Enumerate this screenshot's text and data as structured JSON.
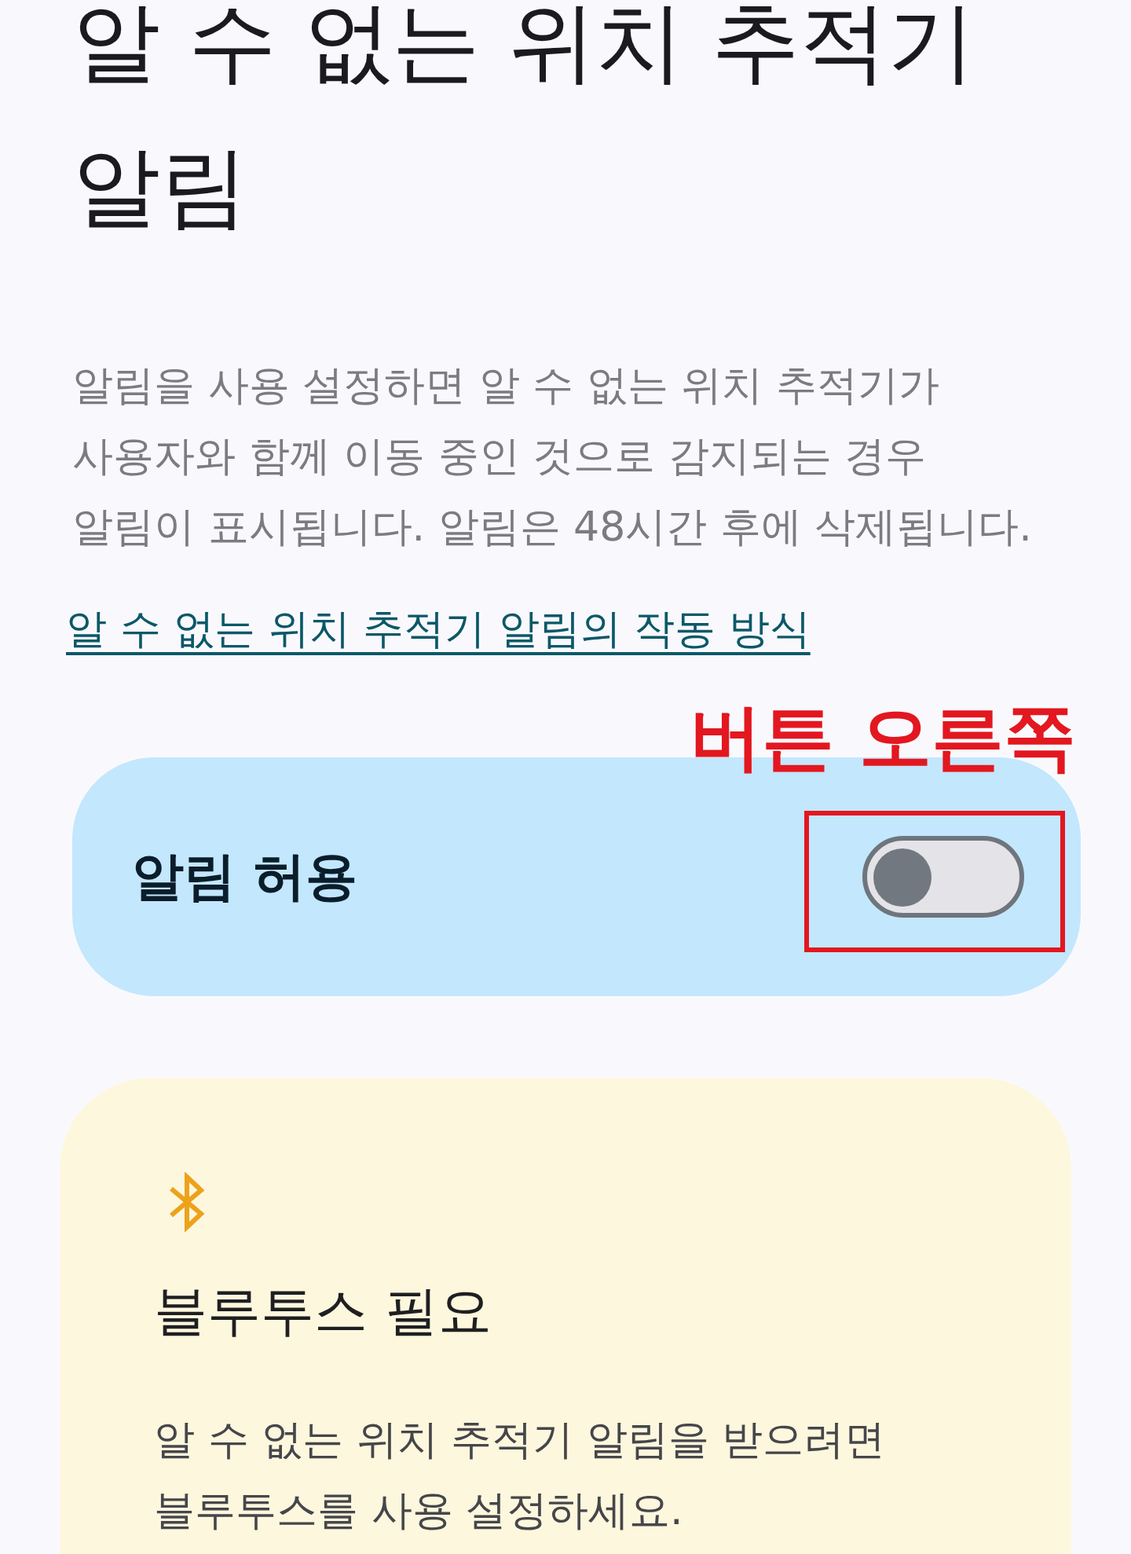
{
  "header": {
    "title": "알 수 없는 위치 추적기 알림",
    "description_lines": [
      "알림을 사용 설정하면 알 수 없는 위치 추적기가",
      "사용자와 함께 이동 중인 것으로 감지되는 경우",
      "알림이 표시됩니다. 알림은 48시간 후에 삭제됩니다."
    ],
    "link": "알 수 없는 위치 추적기 알림의 작동 방식"
  },
  "allow_alerts": {
    "label": "알림 허용",
    "on": false
  },
  "annotation": {
    "label": "버튼 오른쪽",
    "frame": true
  },
  "bluetooth_notice": {
    "title": "블루투스 필요",
    "lines": [
      "알 수 없는 위치 추적기 알림을 받으려면",
      "블루투스를 사용 설정하세요."
    ]
  }
}
